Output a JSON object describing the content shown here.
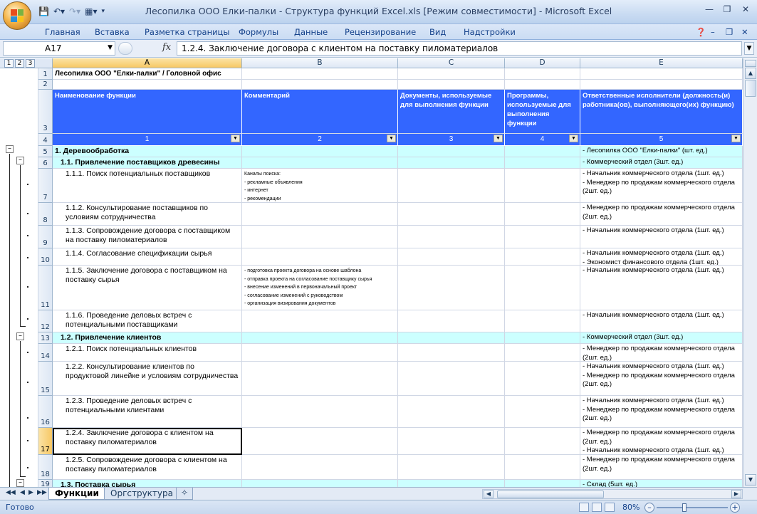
{
  "window": {
    "title": "Лесопилка ООО Елки-палки - Структура функций Excel.xls  [Режим совместимости] - Microsoft Excel"
  },
  "ribbon": {
    "tabs": [
      "Главная",
      "Вставка",
      "Разметка страницы",
      "Формулы",
      "Данные",
      "Рецензирование",
      "Вид",
      "Надстройки"
    ]
  },
  "formula_bar": {
    "name_box": "A17",
    "fx": "fx",
    "formula": "1.2.4. Заключение договора с клиентом на поставку пиломатериалов"
  },
  "outline_levels": [
    "1",
    "2",
    "3"
  ],
  "columns": [
    "A",
    "B",
    "C",
    "D",
    "E"
  ],
  "selected_column": "A",
  "sheet": {
    "title_row": "Лесопилка ООО \"Елки-палки\" / Головной офис",
    "headers": {
      "a": "Наименование функции",
      "b": "Комментарий",
      "c": "Документы, используемые для выполнения функции",
      "d": "Программы, используемые для выполнения функции",
      "e": "Ответственные исполнители (должность(и) работника(ов), выполняющего(их) функцию)"
    },
    "column_numbers": [
      "1",
      "2",
      "3",
      "4",
      "5"
    ],
    "row_numbers": [
      "1",
      "2",
      "3",
      "4",
      "5",
      "6",
      "7",
      "8",
      "9",
      "10",
      "11",
      "12",
      "13",
      "14",
      "15",
      "16",
      "17",
      "18",
      "19"
    ],
    "rows": [
      {
        "a": "1. Деревообработка",
        "b": "",
        "e": "- Лесопилка ООО \"Елки-палки\" (шт. ед.)"
      },
      {
        "a": "1.1. Привлечение поставщиков древесины",
        "b": "",
        "e": "- Коммерческий отдел (3шт. ед.)"
      },
      {
        "a": "1.1.1. Поиск потенциальных поставщиков",
        "b": "Каналы поиска:\n- рекламные объявления\n- интернет\n- рекомендации",
        "e": "- Начальник коммерческого отдела (1шт. ед.)\n- Менеджер по продажам коммерческого отдела (2шт. ед.)"
      },
      {
        "a": "1.1.2. Консультирование поставщиков по условиям сотрудничества",
        "b": "",
        "e": "- Менеджер по продажам коммерческого отдела (2шт. ед.)"
      },
      {
        "a": "1.1.3. Сопровождение договора с поставщиком на поставку пиломатериалов",
        "b": "",
        "e": "- Начальник коммерческого отдела (1шт. ед.)"
      },
      {
        "a": "1.1.4. Согласование спецификации сырья",
        "b": "",
        "e": "- Начальник коммерческого отдела (1шт. ед.)\n- Экономист финансового отдела (1шт. ед.)"
      },
      {
        "a": "1.1.5. Заключение договора с поставщиком на поставку сырья",
        "b": "- подготовка проекта договора на основе шаблона\n- отправка проекта на согласование поставщику сырья\n- внесение изменений в первоначальный проект\n- согласование изменений с руководством\n- организация визирования документов",
        "e": "- Начальник коммерческого отдела (1шт. ед.)"
      },
      {
        "a": "1.1.6. Проведение деловых встреч с потенциальными поставщиками",
        "b": "",
        "e": "- Начальник коммерческого отдела (1шт. ед.)"
      },
      {
        "a": "1.2. Привлечение клиентов",
        "b": "",
        "e": "- Коммерческий отдел (3шт. ед.)"
      },
      {
        "a": "1.2.1. Поиск потенциальных клиентов",
        "b": "",
        "e": "- Менеджер по продажам коммерческого отдела (2шт. ед.)"
      },
      {
        "a": "1.2.2. Консультирование клиентов по продуктовой линейке и условиям сотрудничества",
        "b": "",
        "e": "- Начальник коммерческого отдела (1шт. ед.)\n- Менеджер по продажам коммерческого отдела (2шт. ед.)"
      },
      {
        "a": "1.2.3. Проведение деловых встреч с потенциальными клиентами",
        "b": "",
        "e": "- Начальник коммерческого отдела (1шт. ед.)\n- Менеджер по продажам коммерческого отдела (2шт. ед.)"
      },
      {
        "a": "1.2.4. Заключение договора с клиентом на поставку пиломатериалов",
        "b": "",
        "e": "- Менеджер по продажам коммерческого отдела (2шт. ед.)\n- Начальник коммерческого отдела (1шт. ед.)"
      },
      {
        "a": "1.2.5. Сопровождение договора с клиентом на поставку пиломатериалов",
        "b": "",
        "e": "- Менеджер по продажам коммерческого отдела (2шт. ед.)"
      },
      {
        "a": "1.3. Поставка сырья",
        "b": "",
        "e": "- Склад (5шт. ед.)"
      }
    ]
  },
  "sheet_tabs": [
    "Функции",
    "Оргструктура"
  ],
  "active_sheet": "Функции",
  "status": {
    "ready": "Готово",
    "zoom": "80%"
  },
  "colors": {
    "header_blue": "#3366ff",
    "level_highlight": "#ccffff",
    "selection": "#f7c865"
  }
}
